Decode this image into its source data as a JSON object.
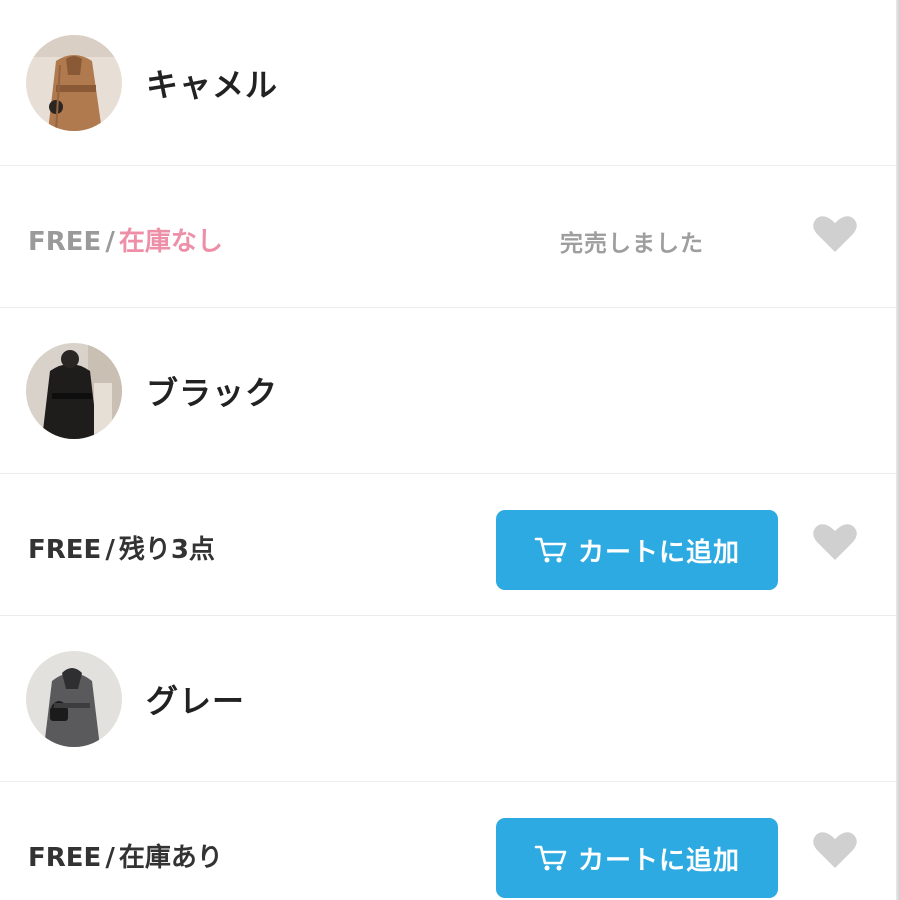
{
  "variants": [
    {
      "color_name": "キャメル",
      "swatch_icon": "camel-coat-photo",
      "size": "FREE",
      "separator": "/",
      "stock_label": "在庫なし",
      "status_text": "完売しました"
    },
    {
      "color_name": "ブラック",
      "swatch_icon": "black-coat-photo",
      "size": "FREE",
      "separator": "/",
      "stock_label": "残り3点",
      "button_label": "カートに追加"
    },
    {
      "color_name": "グレー",
      "swatch_icon": "gray-coat-photo",
      "size": "FREE",
      "separator": "/",
      "stock_label": "在庫あり",
      "button_label": "カートに追加"
    }
  ],
  "icons": {
    "cart": "cart-icon",
    "favorite": "heart-icon"
  },
  "colors": {
    "accent": "#2daae1",
    "out_of_stock": "#ee8fa8",
    "heart": "#d0d0d0",
    "muted_text": "#9a9a9a"
  }
}
